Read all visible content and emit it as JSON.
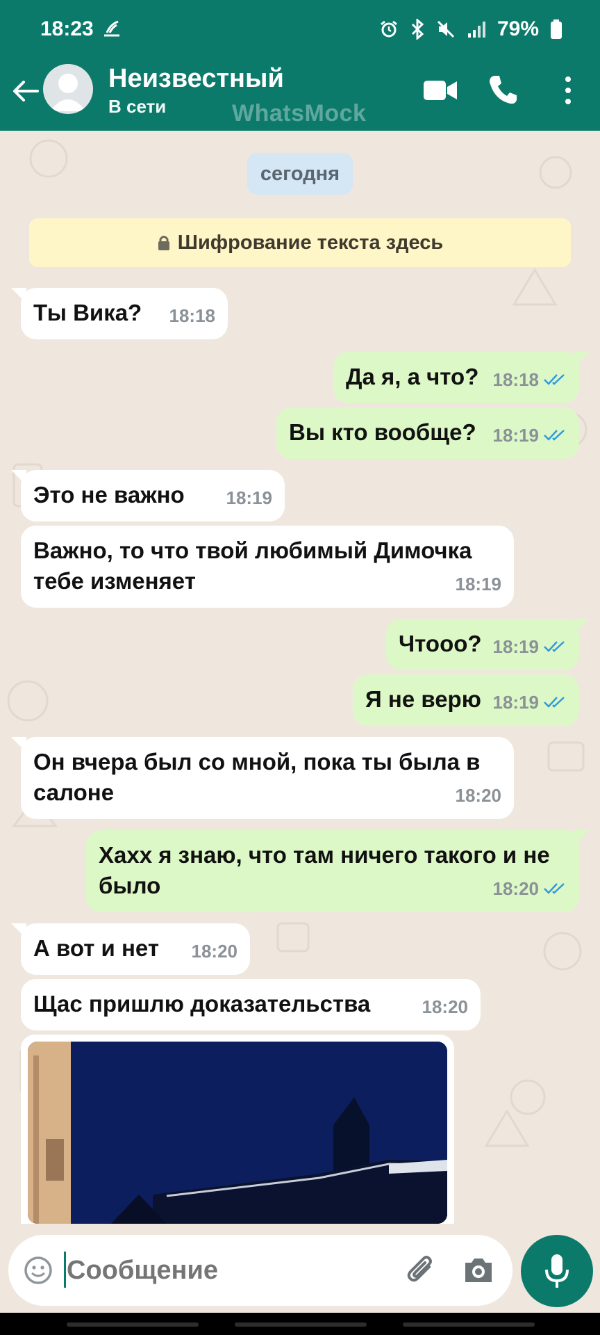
{
  "status_bar": {
    "time": "18:23",
    "battery": "79%"
  },
  "header": {
    "contact_name": "Неизвестный",
    "presence": "В сети",
    "watermark": "WhatsMock",
    "icons": [
      "back-arrow-icon",
      "avatar-icon",
      "video-call-icon",
      "phone-icon",
      "more-vert-icon"
    ]
  },
  "chat": {
    "date_label": "сегодня",
    "encryption_text": "Шифрование текста здесь",
    "messages": [
      {
        "dir": "in",
        "text": "Ты Вика?",
        "time": "18:18"
      },
      {
        "dir": "out",
        "text": "Да я, а что?",
        "time": "18:18",
        "read": true
      },
      {
        "dir": "out",
        "text": "Вы кто вообще?",
        "time": "18:19",
        "read": true
      },
      {
        "dir": "in",
        "text": "Это не важно",
        "time": "18:19"
      },
      {
        "dir": "in",
        "text": "Важно, то что твой любимый Димочка тебе изменяет",
        "time": "18:19"
      },
      {
        "dir": "out",
        "text": "Чтооо?",
        "time": "18:19",
        "read": true
      },
      {
        "dir": "out",
        "text": "Я не верю",
        "time": "18:19",
        "read": true
      },
      {
        "dir": "in",
        "text": "Он вчера был со мной, пока ты была в салоне",
        "time": "18:20"
      },
      {
        "dir": "out",
        "text": "Хахх я знаю, что там ничего такого и не было",
        "time": "18:20",
        "read": true
      },
      {
        "dir": "in",
        "text": "А вот и нет",
        "time": "18:20"
      },
      {
        "dir": "in",
        "text": "Щас пришлю доказательства",
        "time": "18:20"
      }
    ]
  },
  "composer": {
    "placeholder": "Сообщение",
    "icons": [
      "emoji-icon",
      "attach-icon",
      "camera-icon",
      "mic-icon"
    ]
  },
  "colors": {
    "header": "#0b7a6b",
    "chat_bg": "#efe7de",
    "incoming": "#ffffff",
    "outgoing": "#dcf8c6",
    "read_ticks": "#2f9ae0"
  }
}
